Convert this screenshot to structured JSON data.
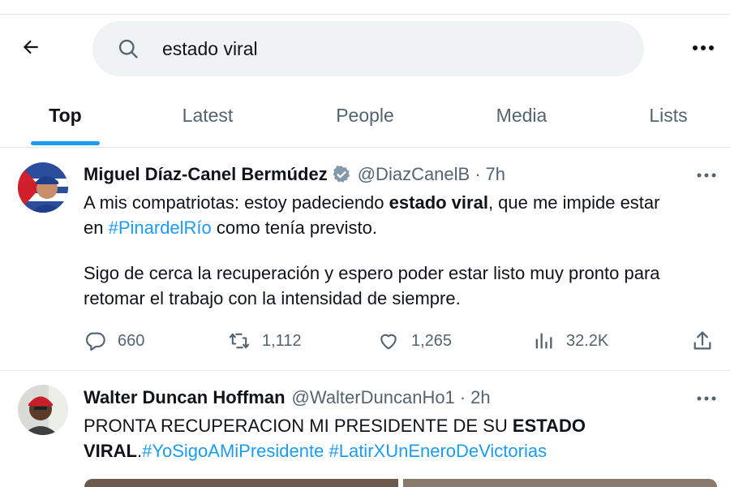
{
  "search": {
    "query": "estado viral"
  },
  "tabs": [
    {
      "label": "Top",
      "active": true
    },
    {
      "label": "Latest",
      "active": false
    },
    {
      "label": "People",
      "active": false
    },
    {
      "label": "Media",
      "active": false
    },
    {
      "label": "Lists",
      "active": false
    }
  ],
  "colors": {
    "accent": "#1d9bf0",
    "secondary_text": "#536471",
    "search_bg": "#eff3f4"
  },
  "tweets": [
    {
      "name": "Miguel Díaz-Canel Bermúdez",
      "verified": true,
      "handle": "@DiazCanelB",
      "dot": "·",
      "time": "7h",
      "text": {
        "l1_a": "A mis compatriotas: estoy padeciendo ",
        "l1_b": "estado viral",
        "l1_c": ", que me impide estar",
        "l2_a": "en ",
        "l2_tag": "#PinardelRío",
        "l2_c": " como tenía previsto.",
        "l3": "Sigo de cerca la recuperación y espero poder estar listo muy pronto  para",
        "l4": "retomar el trabajo con la intensidad de siempre."
      },
      "actions": {
        "replies": "660",
        "reposts": "1,112",
        "likes": "1,265",
        "views": "32.2K"
      },
      "icons": [
        "reply-icon",
        "repost-icon",
        "like-icon",
        "views-icon",
        "share-icon"
      ]
    },
    {
      "name": "Walter Duncan Hoffman",
      "verified": false,
      "handle": "@WalterDuncanHo1",
      "dot": "·",
      "time": "2h",
      "text": {
        "l1_a": "PRONTA RECUPERACION MI PRESIDENTE DE SU ",
        "l1_b": "ESTADO",
        "l2_a": "VIRAL",
        "l2_b": ".",
        "l2_tag1": "#YoSigoAMiPresidente",
        "l2_sp": " ",
        "l2_tag2": "#LatirXUnEneroDeVictorias"
      }
    }
  ]
}
